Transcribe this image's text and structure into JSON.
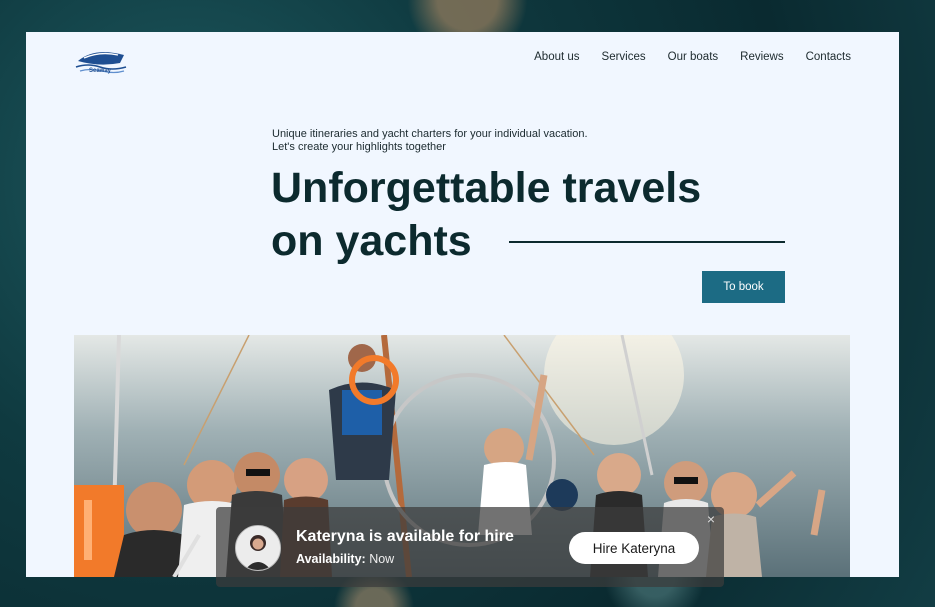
{
  "site": {
    "logo_text": "Seaway",
    "nav": [
      "About us",
      "Services",
      "Our boats",
      "Reviews",
      "Contacts"
    ]
  },
  "hero": {
    "lead": "Unique itineraries and yacht charters for your individual vacation. Let's create your highlights together",
    "title_line1": "Unforgettable travels",
    "title_line2": "on yachts",
    "cta_label": "To book"
  },
  "toast": {
    "title": "Kateryna is available for hire",
    "availability_label": "Availability:",
    "availability_value": "Now",
    "hire_label": "Hire Kateryna",
    "close_symbol": "×"
  },
  "colors": {
    "background_page": "#f1f7ff",
    "accent_button": "#1c6b84",
    "heading": "#0c2a2e"
  }
}
